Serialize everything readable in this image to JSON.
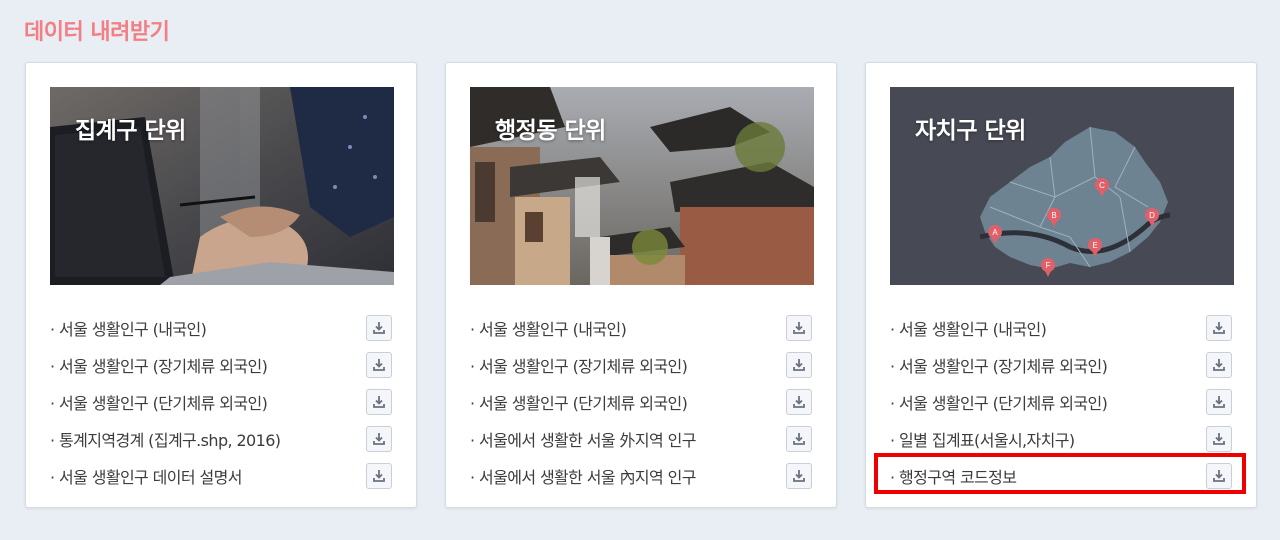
{
  "page": {
    "title": "데이터 내려받기"
  },
  "cards": [
    {
      "title": "집계구 단위",
      "items": [
        "· 서울 생활인구 (내국인)",
        "· 서울 생활인구 (장기체류 외국인)",
        "· 서울 생활인구 (단기체류 외국인)",
        "· 통계지역경계 (집계구.shp, 2016)",
        "· 서울 생활인구 데이터 설명서"
      ]
    },
    {
      "title": "행정동 단위",
      "items": [
        "· 서울 생활인구 (내국인)",
        "· 서울 생활인구 (장기체류 외국인)",
        "· 서울 생활인구 (단기체류 외국인)",
        "· 서울에서 생활한 서울 外지역 인구",
        "· 서울에서 생활한 서울 內지역 인구"
      ]
    },
    {
      "title": "자치구 단위",
      "items": [
        "· 서울 생활인구 (내국인)",
        "· 서울 생활인구 (장기체류 외국인)",
        "· 서울 생활인구 (단기체류 외국인)",
        "· 일별 집계표(서울시,자치구)",
        "· 행정구역 코드정보"
      ],
      "map_markers": [
        "A",
        "B",
        "C",
        "D",
        "E",
        "F"
      ]
    }
  ],
  "icons": {
    "download": "download-icon"
  },
  "colors": {
    "title": "#f37e84",
    "highlight": "#ee0000"
  }
}
